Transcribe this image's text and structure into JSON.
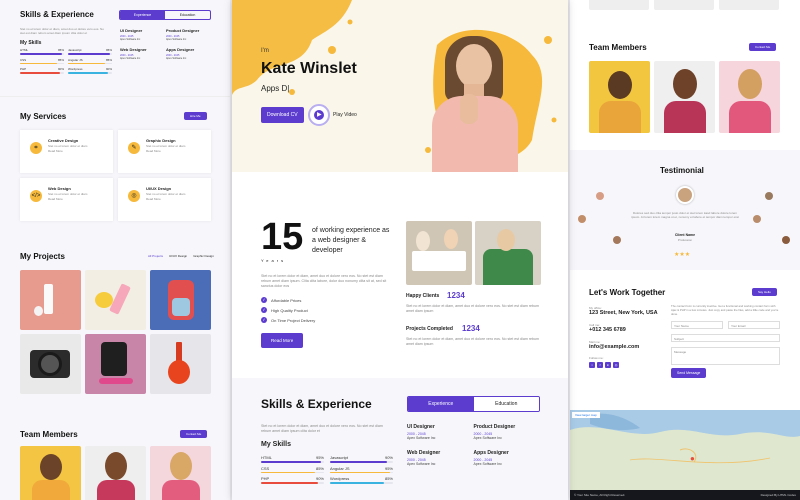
{
  "left": {
    "skills_title": "Skills & Experience",
    "tabs": [
      "Experience",
      "Education"
    ],
    "intro": "Stet no et lorem dolor et diam, amet duo et dolore vero eos. No stet est diam rebum amet diam ipsum clita dolor et",
    "my_skills": "My Skills",
    "skills": [
      {
        "name": "HTML",
        "pct": "95%",
        "level": 0.95,
        "color": "#5b3ccf"
      },
      {
        "name": "Javascript",
        "pct": "95%",
        "level": 0.95,
        "color": "#5b3ccf"
      },
      {
        "name": "CSS",
        "pct": "85%",
        "level": 0.85,
        "color": "#f6b93b"
      },
      {
        "name": "Angular JS",
        "pct": "85%",
        "level": 0.85,
        "color": "#f6b93b"
      },
      {
        "name": "PHP",
        "pct": "90%",
        "level": 0.9,
        "color": "#e74c3c"
      },
      {
        "name": "Wordpress",
        "pct": "90%",
        "level": 0.9,
        "color": "#3ab3e0"
      }
    ],
    "jobs": [
      {
        "title": "UI Designer",
        "years": "2000 - 2045",
        "co": "Apex Software Inc"
      },
      {
        "title": "Product Designer",
        "years": "2000 - 2045",
        "co": "Apex Software Inc"
      },
      {
        "title": "Web Designer",
        "years": "2000 - 2045",
        "co": "Apex Software Inc"
      },
      {
        "title": "Apps Designer",
        "years": "2000 - 2045",
        "co": "Apex Software Inc"
      }
    ],
    "services_title": "My Services",
    "services_btn": "Hire Me",
    "services": [
      {
        "name": "Creative Design",
        "icon": "crop-icon",
        "glyph": "⌗"
      },
      {
        "name": "Graphic Design",
        "icon": "pen-icon",
        "glyph": "✎"
      },
      {
        "name": "Web Design",
        "icon": "code-icon",
        "glyph": "</>"
      },
      {
        "name": "UI/UX Design",
        "icon": "dribbble-icon",
        "glyph": "◎"
      }
    ],
    "service_desc": "Stet no et lorem dolor et diam",
    "service_sub": "Read More",
    "projects_title": "My Projects",
    "project_filters": [
      "All Projects",
      "UI/UX Design",
      "Graphic Design"
    ],
    "team_title": "Team Members",
    "team_btn": "Contact Me"
  },
  "center": {
    "im": "I'm",
    "name": "Kate Winslet",
    "role": "Apps D|",
    "download": "Download CV",
    "play": "Play Video",
    "years_num": "15",
    "years_word": "Years",
    "exp_text": "of working experience as a web designer & developer",
    "para": "Stet no et lorem dolor et diam, amet duo et dolore vero eos. No stet est diam rebum amet diam ipsum. Clita clita labore, dolor duo nonumy clita sit at, sed sit sanctus dolor eos",
    "checks": [
      "Affordable Prices",
      "High Quality Product",
      "On Time Project Delivery"
    ],
    "read_more": "Read More",
    "happy_label": "Happy Clients",
    "happy_num": "1234",
    "happy_desc": "Stet no et lorem dolor et diam, amet duo et dolore vero eos. No stet est diam rebum amet diam ipsum",
    "proj_label": "Projects Completed",
    "proj_num": "1234",
    "proj_desc": "Stet no et lorem dolor et diam, amet duo et dolore vero eos. No stet est diam rebum amet diam ipsum",
    "skills_title": "Skills & Experience",
    "tabs": [
      "Experience",
      "Education"
    ],
    "intro": "Stet no et lorem dolor et diam, amet duo et dolore vero eos. No stet est diam rebum amet diam ipsum clita dolor et",
    "my_skills": "My Skills",
    "skills": [
      {
        "name": "HTML",
        "pct": "95%",
        "level": 0.95,
        "color": "#5b3ccf"
      },
      {
        "name": "Javascript",
        "pct": "90%",
        "level": 0.9,
        "color": "#5b3ccf"
      },
      {
        "name": "CSS",
        "pct": "85%",
        "level": 0.85,
        "color": "#f6b93b"
      },
      {
        "name": "Angular JS",
        "pct": "95%",
        "level": 0.95,
        "color": "#f6b93b"
      },
      {
        "name": "PHP",
        "pct": "90%",
        "level": 0.9,
        "color": "#e74c3c"
      },
      {
        "name": "Wordpress",
        "pct": "85%",
        "level": 0.85,
        "color": "#3ab3e0"
      }
    ],
    "jobs": [
      {
        "title": "UI Designer",
        "years": "2000 - 2045",
        "co": "Apex Software Inc"
      },
      {
        "title": "Product Designer",
        "years": "2000 - 2045",
        "co": "Apex Software Inc"
      },
      {
        "title": "Web Designer",
        "years": "2000 - 2045",
        "co": "Apex Software Inc"
      },
      {
        "title": "Apps Designer",
        "years": "2000 - 2045",
        "co": "Apex Software Inc"
      }
    ]
  },
  "right": {
    "team_title": "Team Members",
    "team_btn": "Contact Me",
    "testimonial_title": "Testimonial",
    "testimonial_text": "Dolores sed duo clita tempor justo dolor et stet lorem kasd labore dolore lorem ipsum. At lorem lorem magna ut et, nonumy et labore et tempor diam tempor erat",
    "client_name": "Client Name",
    "client_prof": "Profession",
    "contact_title": "Let's Work Together",
    "contact_btn": "Say Hello",
    "office_label": "My office:",
    "office": "123 Street, New York, USA",
    "call_label": "Call me:",
    "phone": "+012 345 6789",
    "mail_label": "Mail me:",
    "email": "info@example.com",
    "follow_label": "Follow me:",
    "form_intro": "The contact form is currently inactive. Get a functional and working contact form with Ajax & PHP in a few minutes. Just copy and paste the files, add a little code and you're done.",
    "fields": [
      "Your Name",
      "Your Email",
      "Subject",
      "Message"
    ],
    "send": "Send Message",
    "map_label": "View larger map",
    "footer_left": "© Your Site Name, All Right Reserved.",
    "footer_right": "Designed By HTML Codex"
  },
  "colors": {
    "accent": "#5b3ccf",
    "yellow": "#f6b93b"
  }
}
